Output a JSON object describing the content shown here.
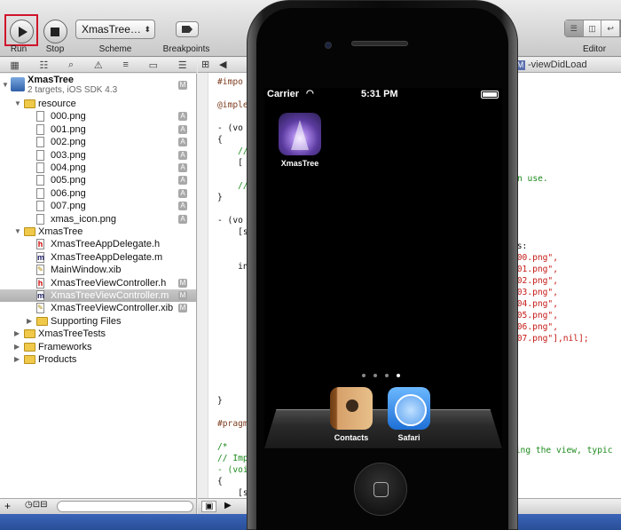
{
  "toolbar": {
    "run_label": "Run",
    "stop_label": "Stop",
    "scheme_value": "XmasTree…",
    "scheme_label": "Scheme",
    "breakpoints_label": "Breakpoints",
    "editor_label": "Editor"
  },
  "navigator": {
    "project": {
      "name": "XmasTree",
      "subtitle": "2 targets, iOS SDK 4.3",
      "badge": "M"
    },
    "items": [
      {
        "label": "resource",
        "kind": "folder",
        "level": 1,
        "badge": ""
      },
      {
        "label": "000.png",
        "kind": "file",
        "level": 2,
        "badge": "A"
      },
      {
        "label": "001.png",
        "kind": "file",
        "level": 2,
        "badge": "A"
      },
      {
        "label": "002.png",
        "kind": "file",
        "level": 2,
        "badge": "A"
      },
      {
        "label": "003.png",
        "kind": "file",
        "level": 2,
        "badge": "A"
      },
      {
        "label": "004.png",
        "kind": "file",
        "level": 2,
        "badge": "A"
      },
      {
        "label": "005.png",
        "kind": "file",
        "level": 2,
        "badge": "A"
      },
      {
        "label": "006.png",
        "kind": "file",
        "level": 2,
        "badge": "A"
      },
      {
        "label": "007.png",
        "kind": "file",
        "level": 2,
        "badge": "A"
      },
      {
        "label": "xmas_icon.png",
        "kind": "file",
        "level": 2,
        "badge": "A"
      },
      {
        "label": "XmasTree",
        "kind": "folder",
        "level": 1,
        "badge": ""
      },
      {
        "label": "XmasTreeAppDelegate.h",
        "kind": "h",
        "level": 2,
        "badge": ""
      },
      {
        "label": "XmasTreeAppDelegate.m",
        "kind": "m",
        "level": 2,
        "badge": ""
      },
      {
        "label": "MainWindow.xib",
        "kind": "xib",
        "level": 2,
        "badge": ""
      },
      {
        "label": "XmasTreeViewController.h",
        "kind": "h",
        "level": 2,
        "badge": "M"
      },
      {
        "label": "XmasTreeViewController.m",
        "kind": "m",
        "level": 2,
        "badge": "M",
        "selected": true
      },
      {
        "label": "XmasTreeViewController.xib",
        "kind": "xib",
        "level": 2,
        "badge": "M"
      },
      {
        "label": "Supporting Files",
        "kind": "folder",
        "level": 2,
        "badge": ""
      },
      {
        "label": "XmasTreeTests",
        "kind": "folder",
        "level": 1,
        "badge": ""
      },
      {
        "label": "Frameworks",
        "kind": "folder",
        "level": 1,
        "badge": ""
      },
      {
        "label": "Products",
        "kind": "folder",
        "level": 1,
        "badge": ""
      }
    ]
  },
  "jumpbar": {
    "method": "-viewDidLoad",
    "file_badge": "M"
  },
  "code": {
    "lines_left": [
      {
        "text": "#impo",
        "cls": "c-dir"
      },
      {
        "text": "",
        "cls": "c-blk"
      },
      {
        "text": "@imple",
        "cls": "c-dir"
      },
      {
        "text": "",
        "cls": "c-blk"
      },
      {
        "text": "- (vo",
        "cls": "c-blk"
      },
      {
        "text": "{",
        "cls": "c-blk"
      },
      {
        "text": "    //",
        "cls": "c-cmt"
      },
      {
        "text": "    [",
        "cls": "c-blk"
      },
      {
        "text": "",
        "cls": "c-blk"
      },
      {
        "text": "    //",
        "cls": "c-cmt"
      },
      {
        "text": "}",
        "cls": "c-blk"
      },
      {
        "text": "",
        "cls": "c-blk"
      },
      {
        "text": "- (vo",
        "cls": "c-blk"
      },
      {
        "text": "    [s",
        "cls": "c-blk"
      },
      {
        "text": "",
        "cls": "c-blk"
      },
      {
        "text": "",
        "cls": "c-blk"
      },
      {
        "text": "    in",
        "cls": "c-blk"
      }
    ],
    "lines_bottom": [
      {
        "text": "}",
        "cls": "c-blk"
      },
      {
        "text": "",
        "cls": "c-blk"
      },
      {
        "text": "#pragm",
        "cls": "c-dir"
      },
      {
        "text": "",
        "cls": "c-blk"
      },
      {
        "text": "/*",
        "cls": "c-cmt"
      },
      {
        "text": "// Imp",
        "cls": "c-cmt"
      },
      {
        "text": "- (voi",
        "cls": "c-cmt"
      },
      {
        "text": "{",
        "cls": "c-blk"
      },
      {
        "text": "    [s",
        "cls": "c-blk"
      },
      {
        "text": "}",
        "cls": "c-blk"
      }
    ],
    "right_comment_1": "n use.",
    "right_ts": "ts:",
    "right_strings": [
      "000.png\",",
      "001.png\",",
      "002.png\",",
      "003.png\",",
      "004.png\",",
      "005.png\",",
      "006.png\",",
      "007.png\"],nil];"
    ],
    "right_bottom_comment": "ding the view, typic"
  },
  "iphone": {
    "carrier": "Carrier",
    "time": "5:31 PM",
    "apps": [
      {
        "label": "XmasTree",
        "icon": "xmas-tree-app-icon"
      },
      {
        "label": "Contacts",
        "icon": "contacts-app-icon"
      },
      {
        "label": "Safari",
        "icon": "safari-app-icon"
      }
    ]
  },
  "colors": {
    "run_highlight": "#d0142a",
    "selection": "#b0b0b0",
    "string": "#c41a16",
    "comment": "#1d8a1d",
    "directive": "#7d3c1e"
  }
}
